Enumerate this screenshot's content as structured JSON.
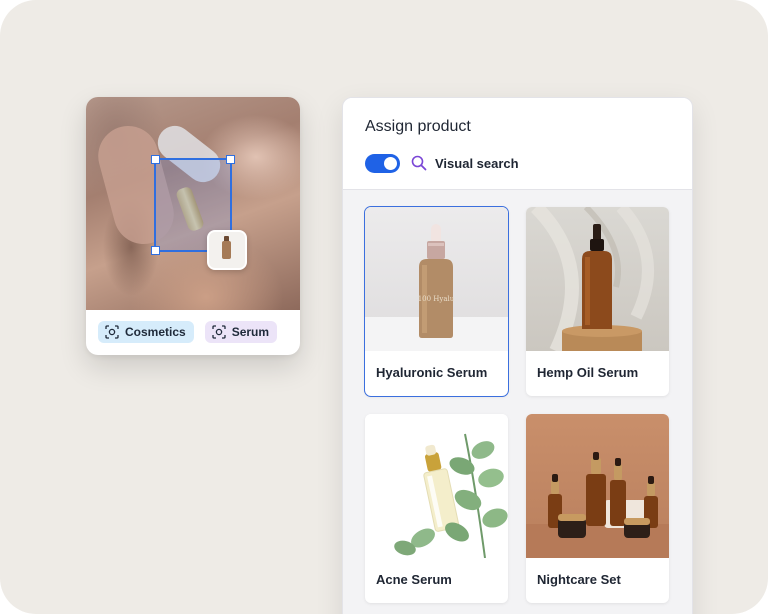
{
  "left_card": {
    "tags": [
      {
        "label": "Cosmetics",
        "color": "#d6ecfb"
      },
      {
        "label": "Serum",
        "color": "#ece4f8"
      }
    ]
  },
  "panel": {
    "title": "Assign product",
    "visual_search": {
      "label": "Visual search",
      "enabled": true
    },
    "products": [
      {
        "name": "Hyaluronic Serum",
        "selected": true,
        "image": "pink-dropper-bottle",
        "bottle_text": "100 Hyalu"
      },
      {
        "name": "Hemp Oil Serum",
        "selected": false,
        "image": "amber-dropper-bottle"
      },
      {
        "name": "Acne Serum",
        "selected": false,
        "image": "clear-bottle-eucalyptus"
      },
      {
        "name": "Nightcare Set",
        "selected": false,
        "image": "amber-bottles-set"
      }
    ]
  },
  "colors": {
    "accent": "#1f62e6",
    "selection": "#2f6fe0",
    "background": "#eeebe6"
  }
}
